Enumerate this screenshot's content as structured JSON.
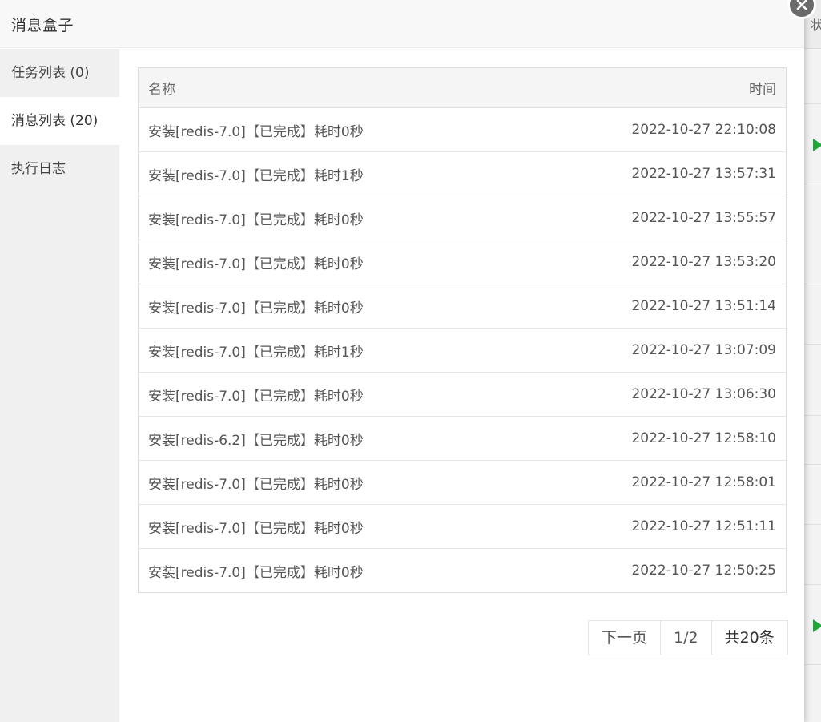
{
  "dialog": {
    "title": "消息盒子"
  },
  "background": {
    "header_fragment": "状"
  },
  "sidebar": {
    "items": [
      {
        "label": "任务列表 (0)"
      },
      {
        "label": "消息列表 (20)"
      },
      {
        "label": "执行日志"
      }
    ]
  },
  "table": {
    "headers": {
      "name": "名称",
      "time": "时间"
    },
    "rows": [
      {
        "name": "安装[redis-7.0]【已完成】耗时0秒",
        "time": "2022-10-27 22:10:08"
      },
      {
        "name": "安装[redis-7.0]【已完成】耗时1秒",
        "time": "2022-10-27 13:57:31"
      },
      {
        "name": "安装[redis-7.0]【已完成】耗时0秒",
        "time": "2022-10-27 13:55:57"
      },
      {
        "name": "安装[redis-7.0]【已完成】耗时0秒",
        "time": "2022-10-27 13:53:20"
      },
      {
        "name": "安装[redis-7.0]【已完成】耗时0秒",
        "time": "2022-10-27 13:51:14"
      },
      {
        "name": "安装[redis-7.0]【已完成】耗时1秒",
        "time": "2022-10-27 13:07:09"
      },
      {
        "name": "安装[redis-7.0]【已完成】耗时0秒",
        "time": "2022-10-27 13:06:30"
      },
      {
        "name": "安装[redis-6.2]【已完成】耗时0秒",
        "time": "2022-10-27 12:58:10"
      },
      {
        "name": "安装[redis-7.0]【已完成】耗时0秒",
        "time": "2022-10-27 12:58:01"
      },
      {
        "name": "安装[redis-7.0]【已完成】耗时0秒",
        "time": "2022-10-27 12:51:11"
      },
      {
        "name": "安装[redis-7.0]【已完成】耗时0秒",
        "time": "2022-10-27 12:50:25"
      }
    ]
  },
  "pagination": {
    "next_label": "下一页",
    "page_indicator": "1/2",
    "total_label": "共20条"
  },
  "colors": {
    "accent_green": "#20a53a",
    "close_button": "#6b6b6b",
    "sidebar_bg": "#f0f0f0"
  }
}
